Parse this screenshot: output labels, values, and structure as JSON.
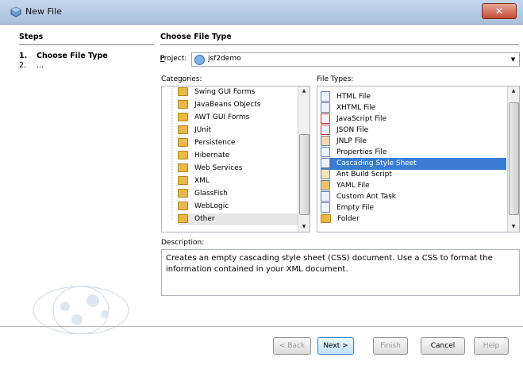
{
  "window": {
    "title": "New File",
    "close_glyph": "✕"
  },
  "steps": {
    "title": "Steps",
    "items": [
      {
        "num": "1.",
        "label": "Choose File Type"
      },
      {
        "num": "2.",
        "label": "..."
      }
    ]
  },
  "main": {
    "title": "Choose File Type",
    "project_label": "Project:",
    "project_value": "jsf2demo",
    "categories_label": "Categories:",
    "file_types_label": "File Types:",
    "description_label": "Description:",
    "description": "Creates an empty cascading style sheet (CSS) document. Use a CSS to format the information contained in your XML document."
  },
  "categories": [
    "Swing GUI Forms",
    "JavaBeans Objects",
    "AWT GUI Forms",
    "JUnit",
    "Persistence",
    "Hibernate",
    "Web Services",
    "XML",
    "GlassFish",
    "WebLogic",
    "Other"
  ],
  "file_types": [
    "HTML File",
    "XHTML File",
    "JavaScript File",
    "JSON File",
    "JNLP File",
    "Properties File",
    "Cascading Style Sheet",
    "Ant Build Script",
    "YAML File",
    "Custom Ant Task",
    "Empty File",
    "Folder"
  ],
  "buttons": {
    "back": "< Back",
    "next": "Next >",
    "finish": "Finish",
    "cancel": "Cancel",
    "help": "Help"
  },
  "colors": {
    "selection": "#3a7bd5",
    "title_bar": "#b8cbe4"
  }
}
